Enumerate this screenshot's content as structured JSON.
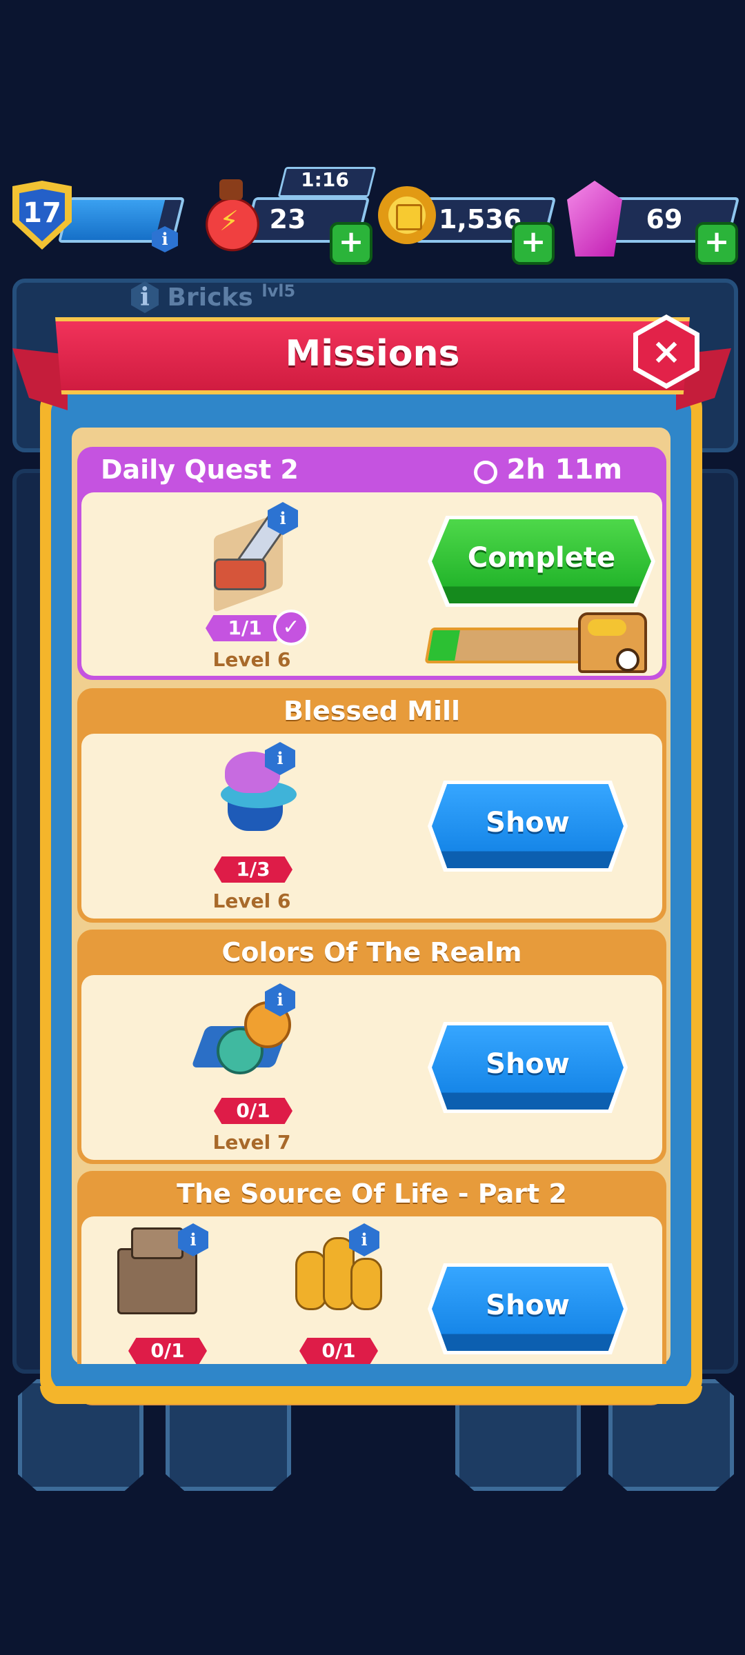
{
  "hud": {
    "player_level": "17",
    "energy": {
      "value": "23",
      "timer": "1:16"
    },
    "coins": {
      "value": "1,536"
    },
    "gems": {
      "value": "69"
    },
    "xp_progress": 0.85
  },
  "background": {
    "building_name": "Bricks",
    "building_level": "lvl5"
  },
  "missions": {
    "title": "Missions",
    "close_icon": "×",
    "daily_quest": {
      "name": "Daily Quest 2",
      "timer": "2h 11m",
      "counter": "1/1",
      "level": "Level 6",
      "button": "Complete",
      "progress": 0.15
    },
    "cards": [
      {
        "name": "Blessed Mill",
        "counter": "1/3",
        "level": "Level 6",
        "button": "Show"
      },
      {
        "name": "Colors Of The Realm",
        "counter": "0/1",
        "level": "Level 7",
        "button": "Show"
      },
      {
        "name": "The Source Of Life - Part 2",
        "counters": [
          "0/1",
          "0/1"
        ],
        "button": "Show"
      }
    ]
  },
  "colors": {
    "background": "#0b1530",
    "ribbon": "#e8254b",
    "frame_gold": "#f4b52b",
    "frame_blue": "#2f86c9",
    "quest_purple": "#c553e0",
    "card_orange": "#e79b3b",
    "button_green": "#23b52b",
    "button_blue": "#1686e8"
  },
  "icons": {
    "player_level": "shield-icon",
    "energy": "potion-icon",
    "coins": "coin-icon",
    "gems": "gem-icon",
    "timer": "stopwatch-icon",
    "info": "info-icon",
    "check": "check-icon",
    "chest": "treasure-chest-icon"
  }
}
